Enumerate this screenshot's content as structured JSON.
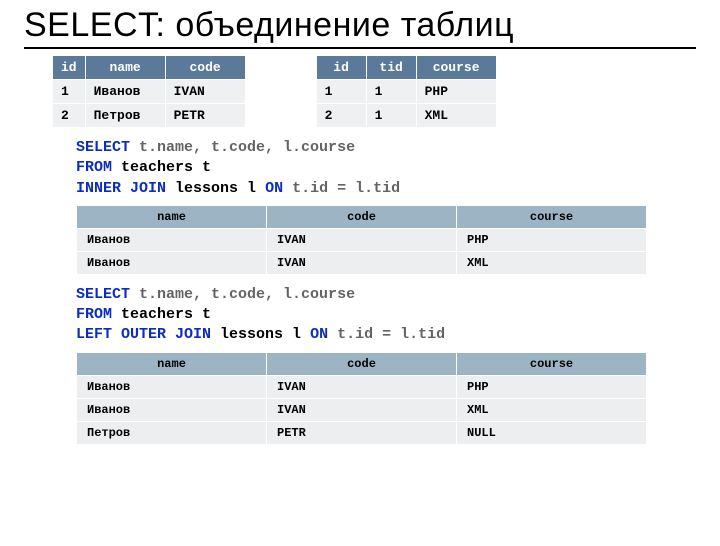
{
  "slide": {
    "title": "SELECT: объединение таблиц"
  },
  "tables": {
    "teachers": {
      "columns": [
        "id",
        "name",
        "code"
      ],
      "rows": [
        {
          "id": "1",
          "name": "Иванов",
          "code": "IVAN"
        },
        {
          "id": "2",
          "name": "Петров",
          "code": "PETR"
        }
      ]
    },
    "lessons": {
      "columns": [
        "id",
        "tid",
        "course"
      ],
      "rows": [
        {
          "id": "1",
          "tid": "1",
          "course": "PHP"
        },
        {
          "id": "2",
          "tid": "1",
          "course": "XML"
        }
      ]
    }
  },
  "query1": {
    "tokens": {
      "select": "SELECT",
      "fields": "t.name, t.code, l.course",
      "from": "FROM",
      "table": "teachers t",
      "join": "INNER JOIN",
      "joined": "lessons l",
      "on": "ON",
      "cond": "t.id = l.tid"
    },
    "result": {
      "columns": [
        "name",
        "code",
        "course"
      ],
      "rows": [
        {
          "name": "Иванов",
          "code": "IVAN",
          "course": "PHP"
        },
        {
          "name": "Иванов",
          "code": "IVAN",
          "course": "XML"
        }
      ]
    }
  },
  "query2": {
    "tokens": {
      "select": "SELECT",
      "fields": "t.name, t.code, l.course",
      "from": "FROM",
      "table": "teachers t",
      "join": "LEFT OUTER JOIN",
      "joined": "lessons l",
      "on": "ON",
      "cond": "t.id = l.tid"
    },
    "result": {
      "columns": [
        "name",
        "code",
        "course"
      ],
      "rows": [
        {
          "name": "Иванов",
          "code": "IVAN",
          "course": "PHP"
        },
        {
          "name": "Иванов",
          "code": "IVAN",
          "course": "XML"
        },
        {
          "name": "Петров",
          "code": "PETR",
          "course": "NULL"
        }
      ]
    }
  }
}
